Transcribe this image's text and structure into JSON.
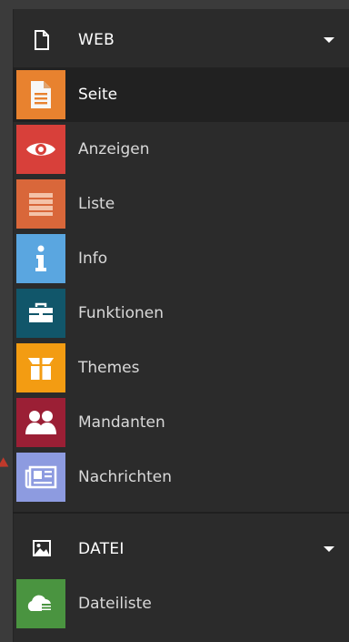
{
  "sections": [
    {
      "title": "WEB",
      "icon": "file-icon",
      "items": [
        {
          "label": "Seite",
          "icon": "document-icon",
          "color": "#e8822f",
          "active": true
        },
        {
          "label": "Anzeigen",
          "icon": "eye-icon",
          "color": "#d8403a"
        },
        {
          "label": "Liste",
          "icon": "list-icon",
          "color": "#d9673a"
        },
        {
          "label": "Info",
          "icon": "info-icon",
          "color": "#5aa6e0"
        },
        {
          "label": "Funktionen",
          "icon": "toolbox-icon",
          "color": "#11566a"
        },
        {
          "label": "Themes",
          "icon": "package-icon",
          "color": "#f39c12"
        },
        {
          "label": "Mandanten",
          "icon": "users-icon",
          "color": "#9b1f35"
        },
        {
          "label": "Nachrichten",
          "icon": "newspaper-icon",
          "color": "#8d9be0"
        }
      ]
    },
    {
      "title": "DATEI",
      "icon": "image-icon",
      "items": [
        {
          "label": "Dateiliste",
          "icon": "cloud-list-icon",
          "color": "#4a9440"
        }
      ]
    }
  ]
}
